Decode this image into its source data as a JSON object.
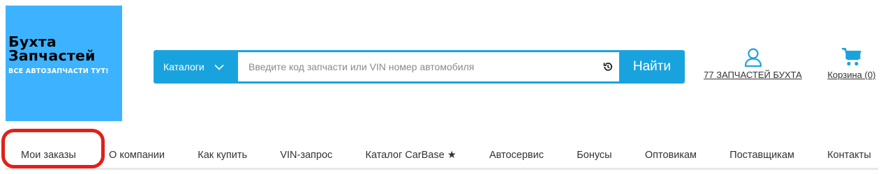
{
  "logo": {
    "line1": "Бухта",
    "line2": "Запчастей",
    "tagline": "ВСЕ АВТОЗАПЧАСТИ ТУТ!",
    "background": "#3db3ff"
  },
  "search": {
    "catalog_label": "Каталоги",
    "catalog_icon": "chevron-down-icon",
    "placeholder": "Введите код запчасти или VIN номер автомобиля",
    "value": "",
    "history_icon": "history-icon",
    "button_label": "Найти",
    "accent_color": "#19a3de"
  },
  "header": {
    "account": {
      "icon": "user-icon",
      "label": "77 ЗАПЧАСТЕЙ БУХТА"
    },
    "cart": {
      "icon": "cart-icon",
      "label": "Корзина (0)"
    }
  },
  "nav": {
    "items": [
      {
        "label": "Мои заказы"
      },
      {
        "label": "О компании"
      },
      {
        "label": "Как купить"
      },
      {
        "label": "VIN-запрос"
      },
      {
        "label": "Каталог CarBase ★"
      },
      {
        "label": "Автосервис"
      },
      {
        "label": "Бонусы"
      },
      {
        "label": "Оптовикам"
      },
      {
        "label": "Поставщикам"
      },
      {
        "label": "Контакты"
      }
    ],
    "highlighted_item": "Мои заказы",
    "highlight_color": "#e0201b"
  }
}
